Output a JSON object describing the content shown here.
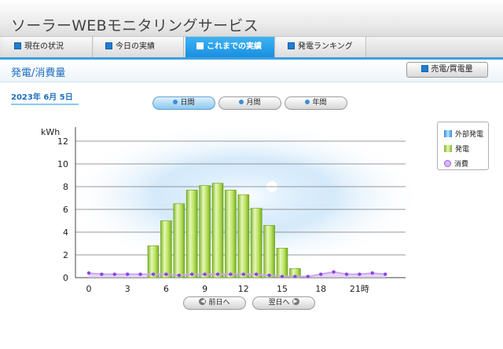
{
  "header": {
    "title": "ソーラーWEBモニタリングサービス"
  },
  "tabs": [
    {
      "label": "現在の状況",
      "active": false
    },
    {
      "label": "今日の実績",
      "active": false
    },
    {
      "label": "これまでの実績",
      "active": true
    },
    {
      "label": "発電ランキング",
      "active": false
    }
  ],
  "section": {
    "title": "発電/消費量",
    "sell_buy_button": "売電/買電量"
  },
  "date_label": "2023年 6月 5日",
  "period_buttons": [
    {
      "label": "日間",
      "active": true
    },
    {
      "label": "月間",
      "active": false
    },
    {
      "label": "年間",
      "active": false
    }
  ],
  "nav": {
    "prev_label": "前日へ",
    "next_label": "翌日へ"
  },
  "legend": {
    "external_generation": "外部発電",
    "generation": "発電",
    "consumption": "消費"
  },
  "colors": {
    "accent": "#1e8fe0",
    "generation": "#a8d84a",
    "external_generation": "#4aa8e8",
    "consumption": "#9b59e6"
  },
  "chart_data": {
    "type": "bar",
    "ylabel": "kWh",
    "ylim": [
      0,
      12
    ],
    "yticks": [
      0,
      2,
      4,
      6,
      8,
      10,
      12
    ],
    "x_tick_labels": [
      "0",
      "3",
      "6",
      "9",
      "12",
      "15",
      "18",
      "21時"
    ],
    "x_tick_hours": [
      0,
      3,
      6,
      9,
      12,
      15,
      18,
      21
    ],
    "x_range": [
      0,
      23
    ],
    "grid": true,
    "legend_position": "right",
    "series": [
      {
        "name": "発電",
        "hours": [
          5,
          6,
          7,
          8,
          9,
          10,
          11,
          12,
          13,
          14,
          15,
          16
        ],
        "values": [
          2.8,
          5.0,
          6.5,
          7.7,
          8.1,
          8.3,
          7.7,
          7.3,
          6.1,
          4.6,
          2.6,
          0.8
        ]
      },
      {
        "name": "外部発電",
        "hours": [],
        "values": []
      },
      {
        "name": "消費",
        "type": "line",
        "hours": [
          0,
          1,
          2,
          3,
          4,
          5,
          6,
          7,
          8,
          9,
          10,
          11,
          12,
          13,
          14,
          15,
          16,
          17,
          18,
          19,
          20,
          21,
          22,
          23
        ],
        "values": [
          0.4,
          0.3,
          0.3,
          0.3,
          0.3,
          0.3,
          0.3,
          0.2,
          0.3,
          0.3,
          0.3,
          0.3,
          0.3,
          0.3,
          0.2,
          0.1,
          0.1,
          0.1,
          0.3,
          0.5,
          0.3,
          0.3,
          0.4,
          0.3
        ]
      }
    ]
  }
}
